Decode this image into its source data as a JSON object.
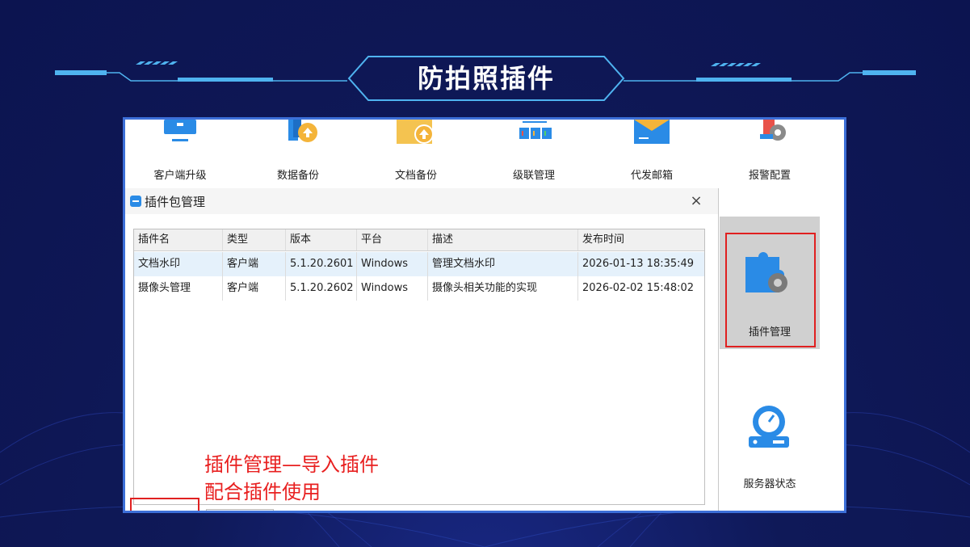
{
  "slide": {
    "title": "防拍照插件",
    "colors": {
      "background": "#0d1550",
      "accent": "#4fb3f0",
      "highlight": "#e02020"
    }
  },
  "toolbar": {
    "items": [
      {
        "label": "客户端升级",
        "icon": "monitor-icon"
      },
      {
        "label": "数据备份",
        "icon": "data-backup-icon"
      },
      {
        "label": "文档备份",
        "icon": "folder-upload-icon"
      },
      {
        "label": "级联管理",
        "icon": "cascade-icon"
      },
      {
        "label": "代发邮箱",
        "icon": "mail-icon"
      },
      {
        "label": "报警配置",
        "icon": "alarm-gear-icon"
      }
    ]
  },
  "side_panel": {
    "plugin_label": "插件管理",
    "server_label": "服务器状态"
  },
  "dialog": {
    "title": "插件包管理",
    "close": "×",
    "columns": [
      "插件名",
      "类型",
      "版本",
      "平台",
      "描述",
      "发布时间"
    ],
    "rows": [
      [
        "文档水印",
        "客户端",
        "5.1.20.2601",
        "Windows",
        "管理文档水印",
        "2026-01-13 18:35:49"
      ],
      [
        "摄像头管理",
        "客户端",
        "5.1.20.2602",
        "Windows",
        "摄像头相关功能的实现",
        "2026-02-02 15:48:02"
      ]
    ]
  },
  "annotation": {
    "line1": "插件管理—导入插件",
    "line2": "配合插件使用"
  }
}
